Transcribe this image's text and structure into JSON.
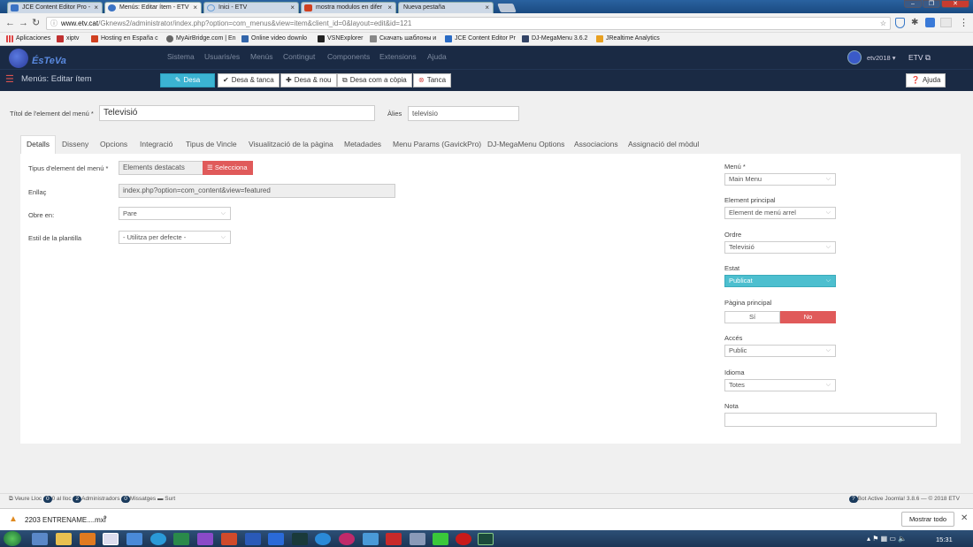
{
  "browser": {
    "tabs": [
      {
        "title": "JCE Content Editor Pro -",
        "color": "#3b73c4"
      },
      {
        "title": "Menús: Editar ítem - ETV",
        "color": "#3b73c4"
      },
      {
        "title": "Inici - ETV",
        "color": "#6aa0d8"
      },
      {
        "title": "mostra modulos en difer",
        "color": "#d04020"
      },
      {
        "title": "Nueva pestaña",
        "color": "#cccccc"
      }
    ],
    "url_host": "www.etv.cat",
    "url_path": "/Gknews2/administrator/index.php?option=com_menus&view=item&client_id=0&layout=edit&id=121",
    "bookmarks": [
      {
        "label": "Aplicaciones",
        "color": "#d04040"
      },
      {
        "label": "xiptv",
        "color": "#c03030"
      },
      {
        "label": "Hosting en España c",
        "color": "#d04020"
      },
      {
        "label": "MyAirBridge.com | En",
        "color": "#666666"
      },
      {
        "label": "Online video downlo",
        "color": "#3366aa"
      },
      {
        "label": "VSNExplorer",
        "color": "#222222"
      },
      {
        "label": "Скачать шаблоны и",
        "color": "#888888"
      },
      {
        "label": "JCE Content Editor Pr",
        "color": "#2a6bc4"
      },
      {
        "label": "DJ-MegaMenu 3.6.2",
        "color": "#334466"
      },
      {
        "label": "JRealtime Analytics",
        "color": "#e8a020"
      }
    ]
  },
  "joomla": {
    "logo": "ÉsTeVa",
    "menu": [
      "Sistema",
      "Usuaris/es",
      "Menús",
      "Contingut",
      "Components",
      "Extensions",
      "Ajuda"
    ],
    "user": "etv2018 ▾",
    "site": "ETV",
    "page_title": "Menús: Editar ítem",
    "toolbar": {
      "save": "Desa",
      "save_close": "Desa & tanca",
      "save_new": "Desa & nou",
      "save_copy": "Desa com a còpia",
      "close": "Tanca",
      "help": "Ajuda"
    },
    "title_label": "Títol de l'element del menú *",
    "title_value": "Televisió",
    "alias_label": "Àlies",
    "alias_value": "televisio",
    "tabs": [
      "Detalls",
      "Disseny",
      "Opcions",
      "Integració",
      "Tipus de Vincle",
      "Visualització de la pàgina",
      "Metadades",
      "Menu Params (GavickPro)",
      "DJ-MegaMenu Options",
      "Associacions",
      "Assignació del mòdul"
    ],
    "details": {
      "type_label": "Tipus d'element del menú *",
      "type_value": "Elements destacats",
      "select_btn": "Selecciona",
      "link_label": "Enllaç",
      "link_value": "index.php?option=com_content&view=featured",
      "open_label": "Obre en:",
      "open_value": "Pare",
      "style_label": "Estil de la plantilla",
      "style_value": "- Utilitza per defecte -"
    },
    "side": {
      "menu_label": "Menú *",
      "menu_value": "Main Menu",
      "parent_label": "Element principal",
      "parent_value": "Element de menú arrel",
      "order_label": "Ordre",
      "order_value": "Televisió",
      "status_label": "Estat",
      "status_value": "Publicat",
      "home_label": "Pàgina principal",
      "home_yes": "Sí",
      "home_no": "No",
      "access_label": "Accés",
      "access_value": "Public",
      "lang_label": "Idioma",
      "lang_value": "Totes",
      "note_label": "Nota"
    },
    "status": {
      "view_site": "Veure Lloc",
      "visitors_count": "0",
      "visitors": "0 al lloc",
      "admins_count": "2",
      "admins": "Administradors",
      "messages_count": "0",
      "messages": "Missatges",
      "logout": "Surt",
      "footer_count": "?",
      "footer": "Bot Active Joomla! 3.8.6  —  © 2018 ETV"
    }
  },
  "download": {
    "file": "2203 ENTRENAME....mxf",
    "show_all": "Mostrar todo"
  },
  "taskbar": {
    "time": "15:31"
  }
}
